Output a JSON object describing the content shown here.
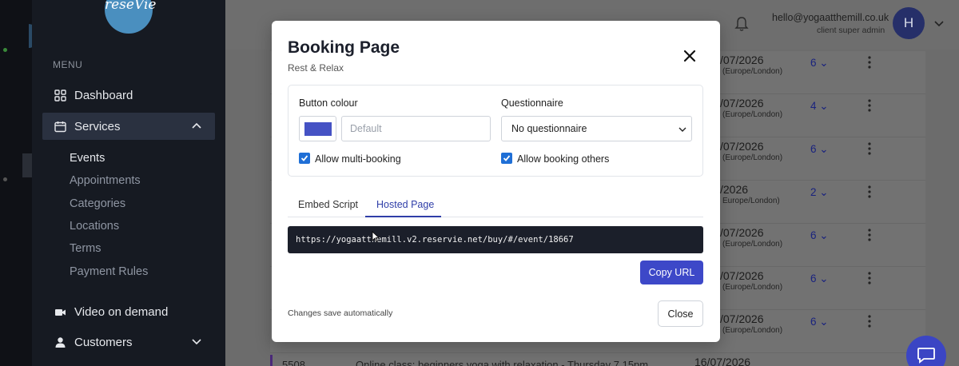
{
  "sidebar": {
    "logo_text": "reseVie",
    "menu_label": "MENU",
    "items": [
      {
        "label": "Dashboard",
        "icon": "grid-icon"
      },
      {
        "label": "Services",
        "icon": "calendar-icon"
      },
      {
        "label": "Video on demand",
        "icon": "video-icon"
      },
      {
        "label": "Customers",
        "icon": "person-icon"
      }
    ],
    "services_sub": [
      "Events",
      "Appointments",
      "Categories",
      "Locations",
      "Terms",
      "Payment Rules"
    ]
  },
  "topbar": {
    "email": "hello@yogaatthemill.co.uk",
    "role": "client super admin",
    "avatar_initial": "H"
  },
  "rows": [
    {
      "date": "/07/2026",
      "tz": "(Europe/London)",
      "count": "6"
    },
    {
      "date": "/07/2026",
      "tz": "(Europe/London)",
      "count": "4"
    },
    {
      "date": "/07/2026",
      "tz": "(Europe/London)",
      "count": "6"
    },
    {
      "date": "/2026",
      "tz": "Europe/London)",
      "count": "2"
    },
    {
      "date": "/07/2026",
      "tz": "(Europe/London)",
      "count": "6"
    },
    {
      "date": "/07/2026",
      "tz": "(Europe/London)",
      "count": "6"
    },
    {
      "date": "/07/2026",
      "tz": "(Europe/London)",
      "count": "6"
    }
  ],
  "bottom_row": {
    "id": "5508",
    "title": "Online class: beginners yoga with relaxation - Thursday 7.15pm",
    "date": "16/07/2026"
  },
  "modal": {
    "title": "Booking Page",
    "subtitle": "Rest & Relax",
    "button_colour_label": "Button colour",
    "button_colour_hex": "#4552c4",
    "button_colour_placeholder": "Default",
    "questionnaire_label": "Questionnaire",
    "questionnaire_value": "No questionnaire",
    "allow_multi_booking_label": "Allow multi-booking",
    "allow_multi_booking": true,
    "allow_booking_others_label": "Allow booking others",
    "allow_booking_others": true,
    "tabs": [
      {
        "label": "Embed Script",
        "active": false
      },
      {
        "label": "Hosted Page",
        "active": true
      }
    ],
    "url": "https://yogaatthemill.v2.reservie.net/buy/#/event/18667",
    "copy_url_label": "Copy URL",
    "hint": "Changes save automatically",
    "close_label": "Close"
  }
}
